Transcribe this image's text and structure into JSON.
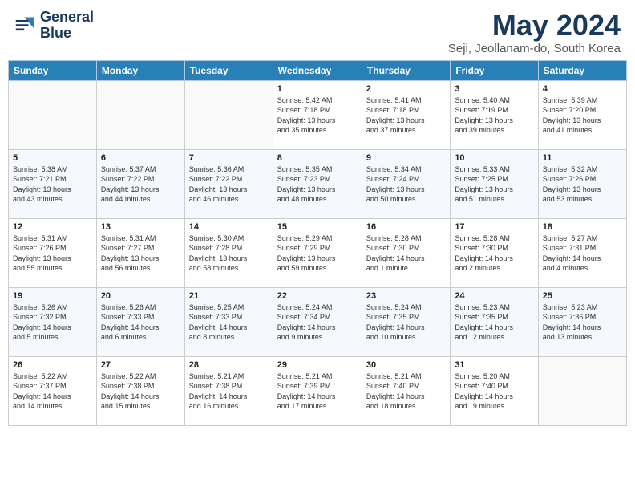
{
  "header": {
    "logo_line1": "General",
    "logo_line2": "Blue",
    "title": "May 2024",
    "subtitle": "Seji, Jeollanam-do, South Korea"
  },
  "days_of_week": [
    "Sunday",
    "Monday",
    "Tuesday",
    "Wednesday",
    "Thursday",
    "Friday",
    "Saturday"
  ],
  "weeks": [
    [
      {
        "day": "",
        "content": ""
      },
      {
        "day": "",
        "content": ""
      },
      {
        "day": "",
        "content": ""
      },
      {
        "day": "1",
        "content": "Sunrise: 5:42 AM\nSunset: 7:18 PM\nDaylight: 13 hours\nand 35 minutes."
      },
      {
        "day": "2",
        "content": "Sunrise: 5:41 AM\nSunset: 7:18 PM\nDaylight: 13 hours\nand 37 minutes."
      },
      {
        "day": "3",
        "content": "Sunrise: 5:40 AM\nSunset: 7:19 PM\nDaylight: 13 hours\nand 39 minutes."
      },
      {
        "day": "4",
        "content": "Sunrise: 5:39 AM\nSunset: 7:20 PM\nDaylight: 13 hours\nand 41 minutes."
      }
    ],
    [
      {
        "day": "5",
        "content": "Sunrise: 5:38 AM\nSunset: 7:21 PM\nDaylight: 13 hours\nand 43 minutes."
      },
      {
        "day": "6",
        "content": "Sunrise: 5:37 AM\nSunset: 7:22 PM\nDaylight: 13 hours\nand 44 minutes."
      },
      {
        "day": "7",
        "content": "Sunrise: 5:36 AM\nSunset: 7:22 PM\nDaylight: 13 hours\nand 46 minutes."
      },
      {
        "day": "8",
        "content": "Sunrise: 5:35 AM\nSunset: 7:23 PM\nDaylight: 13 hours\nand 48 minutes."
      },
      {
        "day": "9",
        "content": "Sunrise: 5:34 AM\nSunset: 7:24 PM\nDaylight: 13 hours\nand 50 minutes."
      },
      {
        "day": "10",
        "content": "Sunrise: 5:33 AM\nSunset: 7:25 PM\nDaylight: 13 hours\nand 51 minutes."
      },
      {
        "day": "11",
        "content": "Sunrise: 5:32 AM\nSunset: 7:26 PM\nDaylight: 13 hours\nand 53 minutes."
      }
    ],
    [
      {
        "day": "12",
        "content": "Sunrise: 5:31 AM\nSunset: 7:26 PM\nDaylight: 13 hours\nand 55 minutes."
      },
      {
        "day": "13",
        "content": "Sunrise: 5:31 AM\nSunset: 7:27 PM\nDaylight: 13 hours\nand 56 minutes."
      },
      {
        "day": "14",
        "content": "Sunrise: 5:30 AM\nSunset: 7:28 PM\nDaylight: 13 hours\nand 58 minutes."
      },
      {
        "day": "15",
        "content": "Sunrise: 5:29 AM\nSunset: 7:29 PM\nDaylight: 13 hours\nand 59 minutes."
      },
      {
        "day": "16",
        "content": "Sunrise: 5:28 AM\nSunset: 7:30 PM\nDaylight: 14 hours\nand 1 minute."
      },
      {
        "day": "17",
        "content": "Sunrise: 5:28 AM\nSunset: 7:30 PM\nDaylight: 14 hours\nand 2 minutes."
      },
      {
        "day": "18",
        "content": "Sunrise: 5:27 AM\nSunset: 7:31 PM\nDaylight: 14 hours\nand 4 minutes."
      }
    ],
    [
      {
        "day": "19",
        "content": "Sunrise: 5:26 AM\nSunset: 7:32 PM\nDaylight: 14 hours\nand 5 minutes."
      },
      {
        "day": "20",
        "content": "Sunrise: 5:26 AM\nSunset: 7:33 PM\nDaylight: 14 hours\nand 6 minutes."
      },
      {
        "day": "21",
        "content": "Sunrise: 5:25 AM\nSunset: 7:33 PM\nDaylight: 14 hours\nand 8 minutes."
      },
      {
        "day": "22",
        "content": "Sunrise: 5:24 AM\nSunset: 7:34 PM\nDaylight: 14 hours\nand 9 minutes."
      },
      {
        "day": "23",
        "content": "Sunrise: 5:24 AM\nSunset: 7:35 PM\nDaylight: 14 hours\nand 10 minutes."
      },
      {
        "day": "24",
        "content": "Sunrise: 5:23 AM\nSunset: 7:35 PM\nDaylight: 14 hours\nand 12 minutes."
      },
      {
        "day": "25",
        "content": "Sunrise: 5:23 AM\nSunset: 7:36 PM\nDaylight: 14 hours\nand 13 minutes."
      }
    ],
    [
      {
        "day": "26",
        "content": "Sunrise: 5:22 AM\nSunset: 7:37 PM\nDaylight: 14 hours\nand 14 minutes."
      },
      {
        "day": "27",
        "content": "Sunrise: 5:22 AM\nSunset: 7:38 PM\nDaylight: 14 hours\nand 15 minutes."
      },
      {
        "day": "28",
        "content": "Sunrise: 5:21 AM\nSunset: 7:38 PM\nDaylight: 14 hours\nand 16 minutes."
      },
      {
        "day": "29",
        "content": "Sunrise: 5:21 AM\nSunset: 7:39 PM\nDaylight: 14 hours\nand 17 minutes."
      },
      {
        "day": "30",
        "content": "Sunrise: 5:21 AM\nSunset: 7:40 PM\nDaylight: 14 hours\nand 18 minutes."
      },
      {
        "day": "31",
        "content": "Sunrise: 5:20 AM\nSunset: 7:40 PM\nDaylight: 14 hours\nand 19 minutes."
      },
      {
        "day": "",
        "content": ""
      }
    ]
  ]
}
